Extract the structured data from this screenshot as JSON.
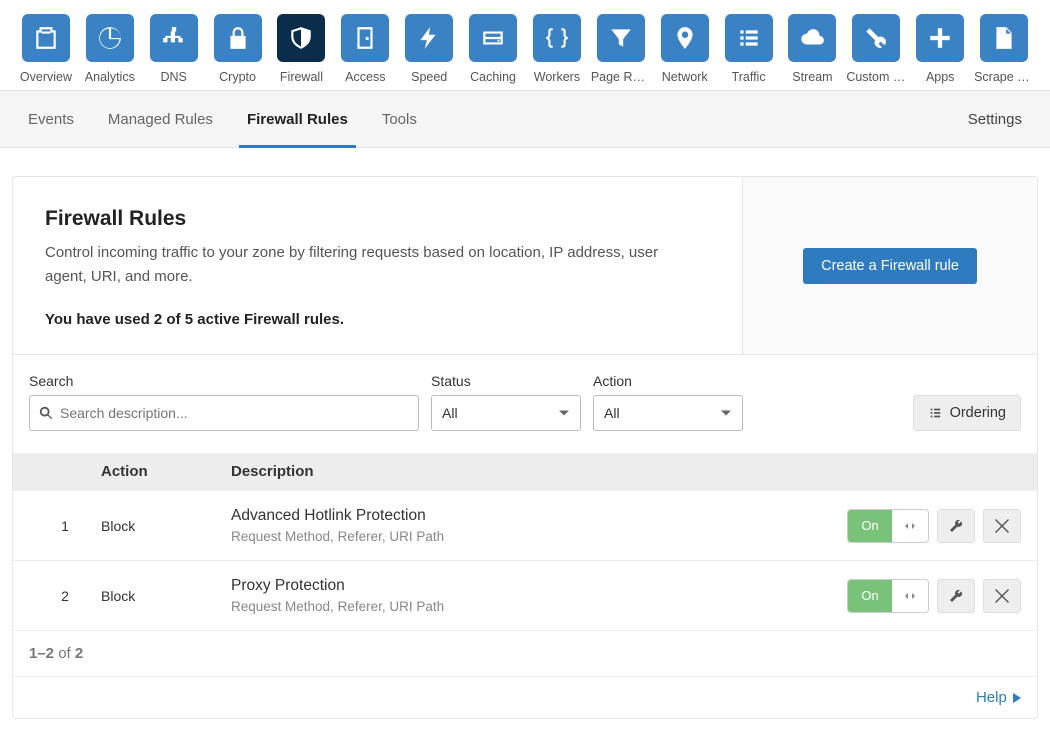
{
  "topnav": [
    {
      "label": "Overview",
      "icon": "clipboard"
    },
    {
      "label": "Analytics",
      "icon": "pie"
    },
    {
      "label": "DNS",
      "icon": "sitemap"
    },
    {
      "label": "Crypto",
      "icon": "lock"
    },
    {
      "label": "Firewall",
      "icon": "shield",
      "active": true
    },
    {
      "label": "Access",
      "icon": "door"
    },
    {
      "label": "Speed",
      "icon": "bolt"
    },
    {
      "label": "Caching",
      "icon": "drive"
    },
    {
      "label": "Workers",
      "icon": "braces"
    },
    {
      "label": "Page Rules",
      "icon": "funnel"
    },
    {
      "label": "Network",
      "icon": "pin"
    },
    {
      "label": "Traffic",
      "icon": "list"
    },
    {
      "label": "Stream",
      "icon": "cloud"
    },
    {
      "label": "Custom Pa...",
      "icon": "wrench"
    },
    {
      "label": "Apps",
      "icon": "plus"
    },
    {
      "label": "Scrape Shi...",
      "icon": "file"
    }
  ],
  "subnav": {
    "tabs": [
      "Events",
      "Managed Rules",
      "Firewall Rules",
      "Tools"
    ],
    "active": "Firewall Rules",
    "right": "Settings"
  },
  "panel": {
    "title": "Firewall Rules",
    "desc": "Control incoming traffic to your zone by filtering requests based on location, IP address, user agent, URI, and more.",
    "usage": "You have used 2 of 5 active Firewall rules.",
    "create_btn": "Create a Firewall rule"
  },
  "filters": {
    "search_label": "Search",
    "search_placeholder": "Search description...",
    "status_label": "Status",
    "status_value": "All",
    "action_label": "Action",
    "action_value": "All",
    "ordering_btn": "Ordering"
  },
  "table": {
    "head_action": "Action",
    "head_desc": "Description",
    "toggle_on": "On",
    "rows": [
      {
        "num": "1",
        "action": "Block",
        "title": "Advanced Hotlink Protection",
        "sub": "Request Method, Referer, URI Path"
      },
      {
        "num": "2",
        "action": "Block",
        "title": "Proxy Protection",
        "sub": "Request Method, Referer, URI Path"
      }
    ]
  },
  "pager": {
    "range": "1–2",
    "of": " of ",
    "total": "2"
  },
  "help": "Help"
}
